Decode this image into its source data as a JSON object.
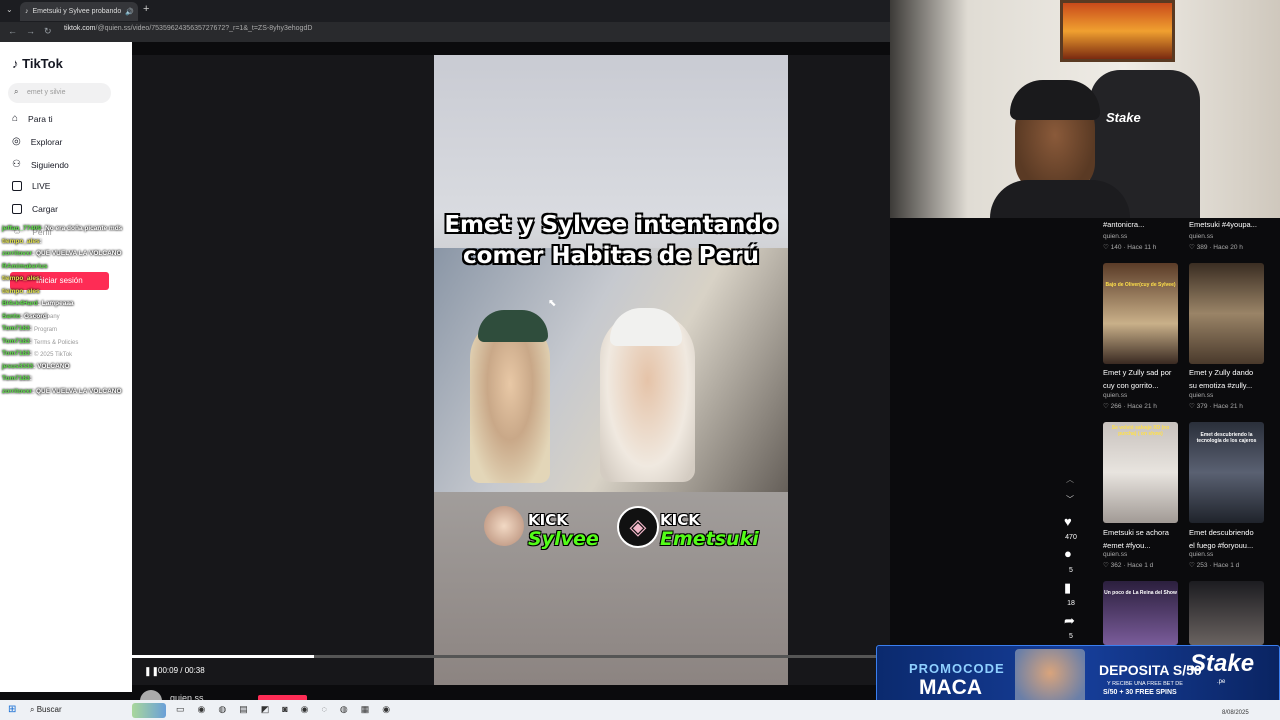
{
  "browser": {
    "tab_title": "Emetsuki y Sylvee probando",
    "url_host": "tiktok.com",
    "url_path": "/@quien.ss/video/7535962435635727672?_r=1&_t=ZS-8yhy3ehogdD"
  },
  "tiktok": {
    "logo": "TikTok",
    "search_placeholder": "emet y silvie",
    "nav": [
      "Para ti",
      "Explorar",
      "Siguiendo",
      "LIVE",
      "Cargar"
    ],
    "nav_hidden": "Perfil",
    "login_button": "Iniciar sesión",
    "faint_links": [
      "Company",
      "Program",
      "Terms & Policies",
      "© 2025 TikTok"
    ]
  },
  "chat": [
    {
      "user": "jeffan_77409",
      "msg": ": No era doña picante mds"
    },
    {
      "user": "tiempo_ales",
      "msg": ":"
    },
    {
      "user": "zorritovxr",
      "msg": ": QUE VUELVA LA VOLCANO"
    },
    {
      "user": "RAmimakerius",
      "msg": ""
    },
    {
      "user": "tiempo_ales",
      "msg": ":"
    },
    {
      "user": "tiempo_ales",
      "msg": ""
    },
    {
      "user": "Bl4ck4Hard",
      "msg": ": Lampeaaa"
    },
    {
      "user": "Santo",
      "msg": ": Gscord"
    },
    {
      "user": "Tom7183",
      "msg": ":"
    },
    {
      "user": "Tom7183",
      "msg": ":"
    },
    {
      "user": "Tom7183",
      "msg": ":"
    },
    {
      "user": "jesus3333",
      "msg": ": VOLCANO"
    },
    {
      "user": "Tom7183",
      "msg": ":"
    },
    {
      "user": "zorritovxr",
      "msg": ": QUE VUELVA LA VOLCANO"
    }
  ],
  "video": {
    "title_line1": "Emet y Sylvee intentando",
    "title_line2": "comer Habitas de Perú",
    "kick_label": "KICK",
    "streamer1": "Sylvee",
    "streamer2": "Emetsuki",
    "time": "00:09 / 00:38",
    "progress": 0.24,
    "author": "quien.ss"
  },
  "actions": {
    "likes": "470",
    "comments": "5",
    "saves": "18",
    "shares": "5"
  },
  "grid": [
    {
      "caption1": "#antonicra...",
      "caption2": "",
      "user": "quien.ss",
      "stat": "140 · Hace 11 h"
    },
    {
      "caption1": "Emetsuki #4youpa...",
      "caption2": "",
      "user": "quien.ss",
      "stat": "389 · Hace 20 h"
    },
    {
      "caption1": "Emet y Zully sad por",
      "caption2": "cuy con gorrito...",
      "user": "quien.ss",
      "stat": "266 · Hace 21 h",
      "thumb_text": "Bajo de Oliver(cuy de Sylvee)"
    },
    {
      "caption1": "Emet y Zully dando",
      "caption2": "su emotiza #zully...",
      "user": "quien.ss",
      "stat": "379 · Hace 21 h"
    },
    {
      "caption1": "Emetsuki se achora",
      "caption2": "#emet #fyou...",
      "user": "quien.ss",
      "stat": "362 · Hace 1 d",
      "thumb_text": "Se volvió salvaje XD (no purcha) ( on show)"
    },
    {
      "caption1": "Emet descubriendo",
      "caption2": "el fuego #foryouu...",
      "user": "quien.ss",
      "stat": "253 · Hace 1 d",
      "thumb_text": "Emet descubriendo la tecnología de los cajeros"
    },
    {
      "caption1": "",
      "caption2": "",
      "user": "",
      "stat": "",
      "thumb_text": "Un poco de La Reina del Show"
    },
    {
      "caption1": "",
      "caption2": "",
      "user": "",
      "stat": ""
    }
  ],
  "banner": {
    "promo_label": "PROMOCODE",
    "promo_code": "MACA",
    "deposit": "DEPOSITA S/50",
    "sub1": "Y RECIBE UNA FREE BET DE",
    "sub2": "S/50 + 30 FREE SPINS",
    "brand": "Stake",
    "brand_sub": ".pe"
  },
  "webcam": {
    "chair_brand": "Stake"
  },
  "taskbar": {
    "search": "Buscar",
    "date": "8/08/2025"
  }
}
